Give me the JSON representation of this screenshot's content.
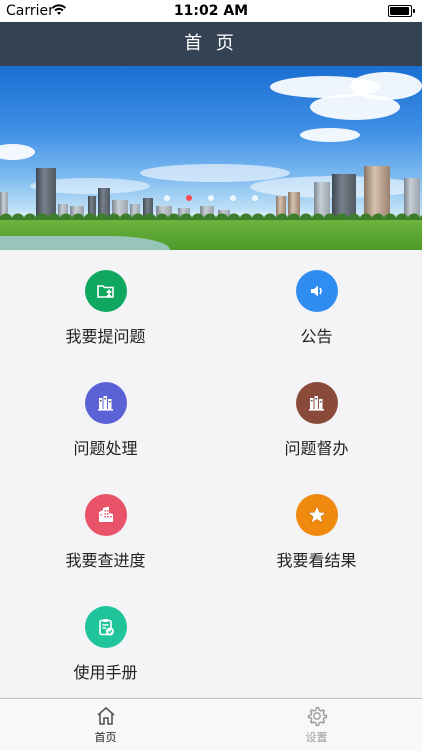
{
  "status_bar": {
    "carrier": "Carrier",
    "time": "11:02 AM"
  },
  "navbar": {
    "title": "首 页"
  },
  "banner": {
    "slide_count": 5,
    "active_slide_index": 1
  },
  "menu": [
    {
      "label": "我要提问题",
      "icon": "folder-upload-icon",
      "color": "#10a860"
    },
    {
      "label": "公告",
      "icon": "speaker-icon",
      "color": "#2f8cf0"
    },
    {
      "label": "问题处理",
      "icon": "books-icon",
      "color": "#5b62d6"
    },
    {
      "label": "问题督办",
      "icon": "books-icon",
      "color": "#8a4a3a"
    },
    {
      "label": "我要查进度",
      "icon": "building-icon",
      "color": "#e8536a"
    },
    {
      "label": "我要看结果",
      "icon": "star-icon",
      "color": "#f08a0e"
    },
    {
      "label": "使用手册",
      "icon": "clipboard-check-icon",
      "color": "#1fc49a"
    }
  ],
  "tabbar": {
    "items": [
      {
        "label": "首页",
        "icon": "home-icon",
        "active": true
      },
      {
        "label": "设置",
        "icon": "gear-icon",
        "active": false
      }
    ],
    "active_color": "#222222",
    "inactive_color": "#9a9a9a"
  }
}
